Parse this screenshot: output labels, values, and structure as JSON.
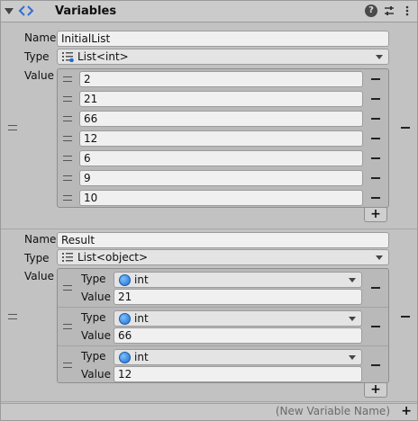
{
  "header": {
    "title": "Variables",
    "help_glyph": "?"
  },
  "labels": {
    "name": "Name",
    "type": "Type",
    "value": "Value"
  },
  "variables": [
    {
      "name": "InitialList",
      "type": "List<int>",
      "values": [
        "2",
        "21",
        "66",
        "12",
        "6",
        "9",
        "10"
      ]
    },
    {
      "name": "Result",
      "type": "List<object>",
      "entries": [
        {
          "type": "int",
          "value": "21"
        },
        {
          "type": "int",
          "value": "66"
        },
        {
          "type": "int",
          "value": "12"
        }
      ]
    }
  ],
  "footer": {
    "new_variable_placeholder": "(New Variable Name)",
    "add_label": "+"
  },
  "buttons": {
    "add": "+"
  },
  "colors": {
    "int_icon": "#1d6fd0",
    "background": "#c2c2c2"
  },
  "icons": [
    "foldout-arrow-icon",
    "code-brackets-icon",
    "help-icon",
    "presets-icon",
    "kebab-menu-icon",
    "list-type-icon",
    "int-type-icon",
    "drag-handle-icon",
    "remove-icon",
    "add-icon"
  ]
}
